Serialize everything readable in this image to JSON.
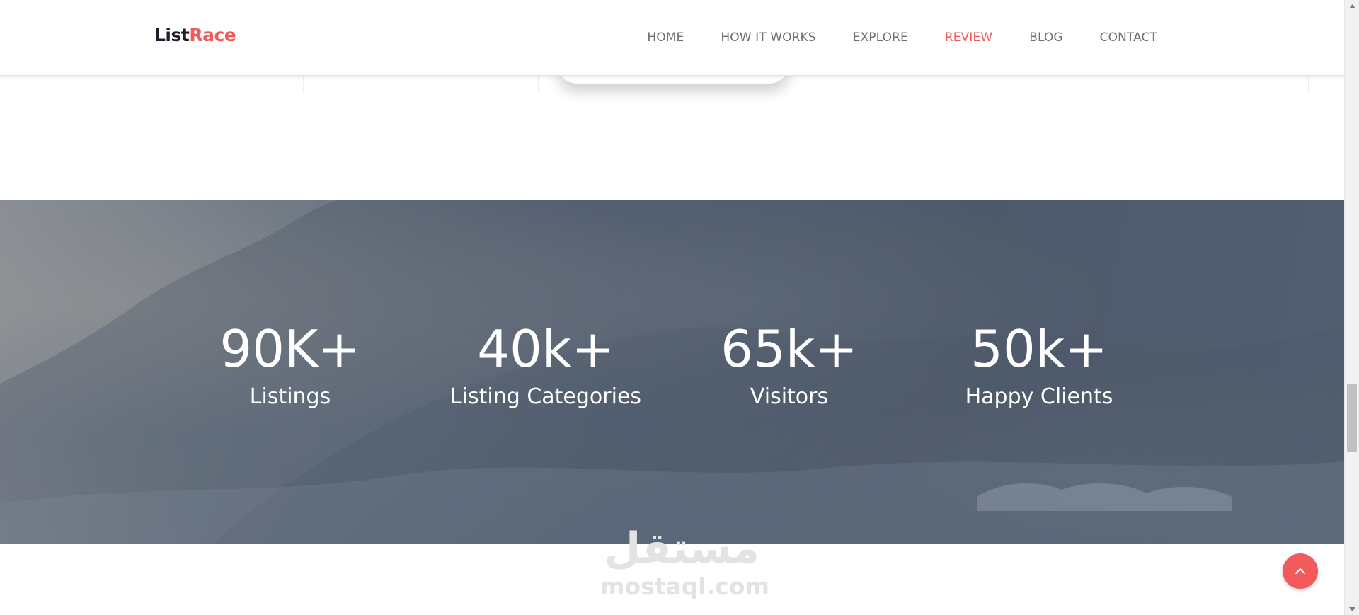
{
  "header": {
    "logo_part1": "List",
    "logo_part2": "Race",
    "nav": [
      {
        "label": "HOME",
        "active": false
      },
      {
        "label": "HOW IT WORKS",
        "active": false
      },
      {
        "label": "EXPLORE",
        "active": false
      },
      {
        "label": "REVIEW",
        "active": true
      },
      {
        "label": "BLOG",
        "active": false
      },
      {
        "label": "CONTACT",
        "active": false
      }
    ]
  },
  "stats": [
    {
      "value": "90K+",
      "label": "Listings"
    },
    {
      "value": "40k+",
      "label": "Listing Categories"
    },
    {
      "value": "65k+",
      "label": "Visitors"
    },
    {
      "value": "50k+",
      "label": "Happy Clients"
    }
  ],
  "watermark": {
    "arabic": "مستقل",
    "latin": "mostaql.com"
  },
  "colors": {
    "accent": "#f35a5b",
    "logo_dark": "#1f1f2b",
    "nav_text": "#6f6f6f"
  },
  "icons": {
    "scroll_top": "chevron-up-icon"
  }
}
